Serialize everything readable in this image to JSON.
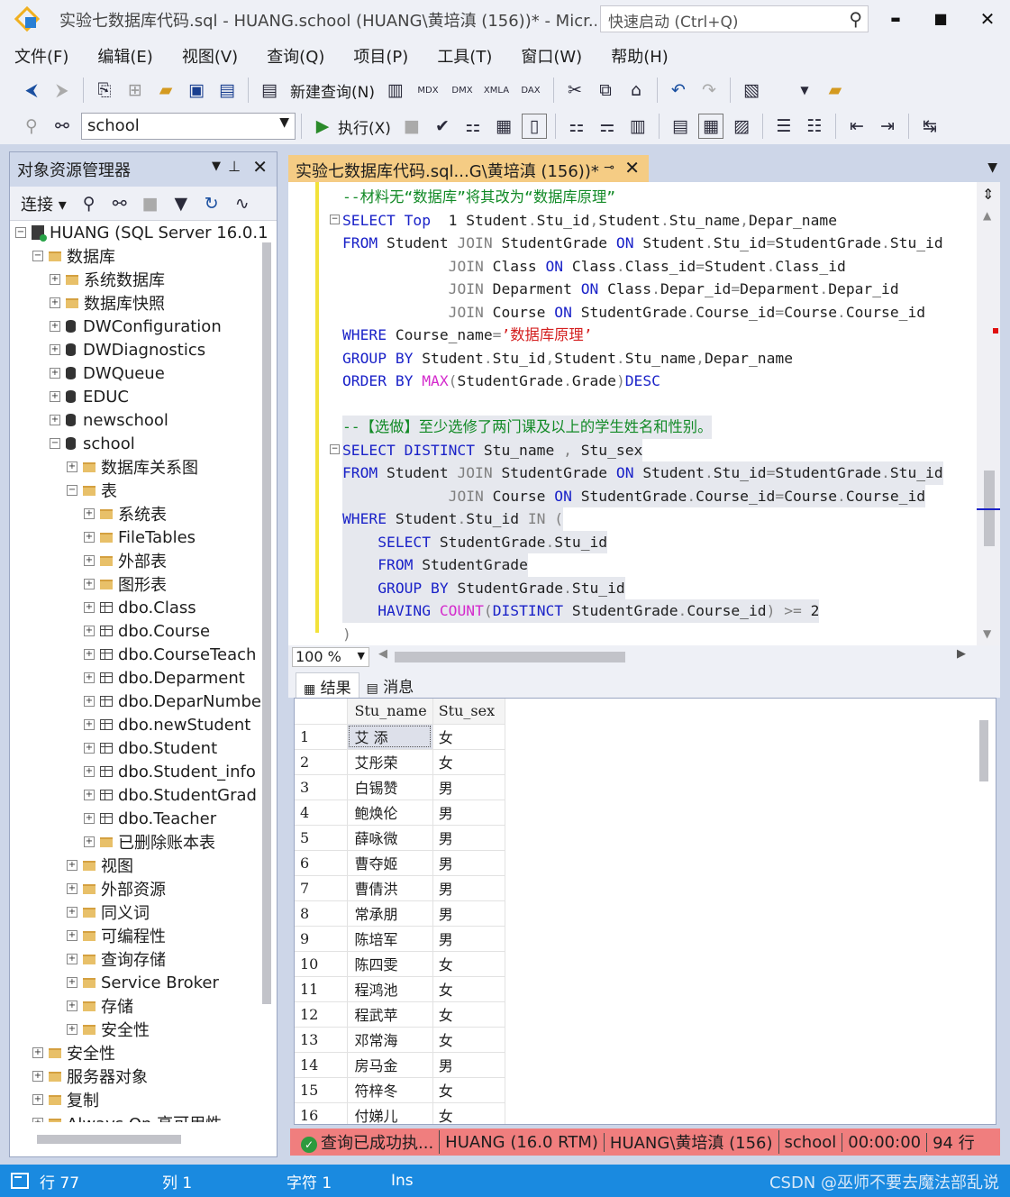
{
  "window": {
    "title": "实验七数据库代码.sql - HUANG.school (HUANG\\黄培滇 (156))* - Micr...",
    "quick_launch_placeholder": "快速启动 (Ctrl+Q)",
    "minimize": "▬",
    "maximize": "■",
    "close": "✕"
  },
  "menu": [
    "文件(F)",
    "编辑(E)",
    "视图(V)",
    "查询(Q)",
    "项目(P)",
    "工具(T)",
    "窗口(W)",
    "帮助(H)"
  ],
  "toolbar": {
    "new_query_label": "新建查询(N)",
    "database_value": "school",
    "execute_label": "执行(X)",
    "mdx": "MDX",
    "dmx": "DMX",
    "xmla": "XMLA",
    "dax": "DAX"
  },
  "object_explorer": {
    "title": "对象资源管理器",
    "connect_label": "连接",
    "server": "HUANG (SQL Server 16.0.1",
    "nodes": [
      {
        "label": "数据库",
        "indent": 1,
        "kind": "folder",
        "expanded": true
      },
      {
        "label": "系统数据库",
        "indent": 2,
        "kind": "folder"
      },
      {
        "label": "数据库快照",
        "indent": 2,
        "kind": "folder"
      },
      {
        "label": "DWConfiguration",
        "indent": 2,
        "kind": "db"
      },
      {
        "label": "DWDiagnostics",
        "indent": 2,
        "kind": "db"
      },
      {
        "label": "DWQueue",
        "indent": 2,
        "kind": "db"
      },
      {
        "label": "EDUC",
        "indent": 2,
        "kind": "db"
      },
      {
        "label": "newschool",
        "indent": 2,
        "kind": "db"
      },
      {
        "label": "school",
        "indent": 2,
        "kind": "db",
        "expanded": true
      },
      {
        "label": "数据库关系图",
        "indent": 3,
        "kind": "folder"
      },
      {
        "label": "表",
        "indent": 3,
        "kind": "folder",
        "expanded": true
      },
      {
        "label": "系统表",
        "indent": 4,
        "kind": "folder"
      },
      {
        "label": "FileTables",
        "indent": 4,
        "kind": "folder"
      },
      {
        "label": "外部表",
        "indent": 4,
        "kind": "folder"
      },
      {
        "label": "图形表",
        "indent": 4,
        "kind": "folder"
      },
      {
        "label": "dbo.Class",
        "indent": 4,
        "kind": "table"
      },
      {
        "label": "dbo.Course",
        "indent": 4,
        "kind": "table"
      },
      {
        "label": "dbo.CourseTeach",
        "indent": 4,
        "kind": "table"
      },
      {
        "label": "dbo.Deparment",
        "indent": 4,
        "kind": "table"
      },
      {
        "label": "dbo.DeparNumbe",
        "indent": 4,
        "kind": "table"
      },
      {
        "label": "dbo.newStudent",
        "indent": 4,
        "kind": "table"
      },
      {
        "label": "dbo.Student",
        "indent": 4,
        "kind": "table"
      },
      {
        "label": "dbo.Student_info",
        "indent": 4,
        "kind": "table"
      },
      {
        "label": "dbo.StudentGrad",
        "indent": 4,
        "kind": "table"
      },
      {
        "label": "dbo.Teacher",
        "indent": 4,
        "kind": "table"
      },
      {
        "label": "已删除账本表",
        "indent": 4,
        "kind": "folder"
      },
      {
        "label": "视图",
        "indent": 3,
        "kind": "folder"
      },
      {
        "label": "外部资源",
        "indent": 3,
        "kind": "folder"
      },
      {
        "label": "同义词",
        "indent": 3,
        "kind": "folder"
      },
      {
        "label": "可编程性",
        "indent": 3,
        "kind": "folder"
      },
      {
        "label": "查询存储",
        "indent": 3,
        "kind": "folder"
      },
      {
        "label": "Service Broker",
        "indent": 3,
        "kind": "folder"
      },
      {
        "label": "存储",
        "indent": 3,
        "kind": "folder"
      },
      {
        "label": "安全性",
        "indent": 3,
        "kind": "folder"
      },
      {
        "label": "安全性",
        "indent": 1,
        "kind": "folder"
      },
      {
        "label": "服务器对象",
        "indent": 1,
        "kind": "folder"
      },
      {
        "label": "复制",
        "indent": 1,
        "kind": "folder"
      },
      {
        "label": "Always On 高可用性",
        "indent": 1,
        "kind": "folder"
      }
    ]
  },
  "editor": {
    "tab_label": "实验七数据库代码.sql...G\\黄培滇 (156))*",
    "zoom": "100 %",
    "lines": [
      [
        [
          "cm",
          "--材料无“数据库”将其改为“数据库原理”"
        ]
      ],
      [
        [
          "kw",
          "SELECT Top"
        ],
        [
          "",
          "  1 Student"
        ],
        [
          "gr",
          "."
        ],
        [
          "",
          "Stu_id"
        ],
        [
          "gr",
          ","
        ],
        [
          "",
          "Student"
        ],
        [
          "gr",
          "."
        ],
        [
          "",
          "Stu_name"
        ],
        [
          "gr",
          ","
        ],
        [
          "",
          "Depar_name"
        ]
      ],
      [
        [
          "kw",
          "FROM"
        ],
        [
          "",
          " Student "
        ],
        [
          "gr",
          "JOIN"
        ],
        [
          "",
          " StudentGrade "
        ],
        [
          "kw",
          "ON"
        ],
        [
          "",
          " Student"
        ],
        [
          "gr",
          "."
        ],
        [
          "",
          "Stu_id"
        ],
        [
          "gr",
          "="
        ],
        [
          "",
          "StudentGrade"
        ],
        [
          "gr",
          "."
        ],
        [
          "",
          "Stu_id"
        ]
      ],
      [
        [
          "",
          "            "
        ],
        [
          "gr",
          "JOIN"
        ],
        [
          "",
          " Class "
        ],
        [
          "kw",
          "ON"
        ],
        [
          "",
          " Class"
        ],
        [
          "gr",
          "."
        ],
        [
          "",
          "Class_id"
        ],
        [
          "gr",
          "="
        ],
        [
          "",
          "Student"
        ],
        [
          "gr",
          "."
        ],
        [
          "",
          "Class_id"
        ]
      ],
      [
        [
          "",
          "            "
        ],
        [
          "gr",
          "JOIN"
        ],
        [
          "",
          " Deparment "
        ],
        [
          "kw",
          "ON"
        ],
        [
          "",
          " Class"
        ],
        [
          "gr",
          "."
        ],
        [
          "",
          "Depar_id"
        ],
        [
          "gr",
          "="
        ],
        [
          "",
          "Deparment"
        ],
        [
          "gr",
          "."
        ],
        [
          "",
          "Depar_id"
        ]
      ],
      [
        [
          "",
          "            "
        ],
        [
          "gr",
          "JOIN"
        ],
        [
          "",
          " Course "
        ],
        [
          "kw",
          "ON"
        ],
        [
          "",
          " StudentGrade"
        ],
        [
          "gr",
          "."
        ],
        [
          "",
          "Course_id"
        ],
        [
          "gr",
          "="
        ],
        [
          "",
          "Course"
        ],
        [
          "gr",
          "."
        ],
        [
          "",
          "Course_id"
        ]
      ],
      [
        [
          "kw",
          "WHERE"
        ],
        [
          "",
          " Course_name"
        ],
        [
          "gr",
          "="
        ],
        [
          "str",
          "’数据库原理’"
        ]
      ],
      [
        [
          "kw",
          "GROUP BY"
        ],
        [
          "",
          " Student"
        ],
        [
          "gr",
          "."
        ],
        [
          "",
          "Stu_id"
        ],
        [
          "gr",
          ","
        ],
        [
          "",
          "Student"
        ],
        [
          "gr",
          "."
        ],
        [
          "",
          "Stu_name"
        ],
        [
          "gr",
          ","
        ],
        [
          "",
          "Depar_name"
        ]
      ],
      [
        [
          "kw",
          "ORDER BY"
        ],
        [
          "",
          " "
        ],
        [
          "fn",
          "MAX"
        ],
        [
          "gr",
          "("
        ],
        [
          "",
          "StudentGrade"
        ],
        [
          "gr",
          "."
        ],
        [
          "",
          "Grade"
        ],
        [
          "gr",
          ")"
        ],
        [
          "kw",
          "DESC"
        ]
      ],
      [
        [
          "",
          ""
        ]
      ],
      [
        [
          "cm",
          "--【选做】至少选修了两门课及以上的学生姓名和性别。"
        ]
      ],
      [
        [
          "kw",
          "SELECT DISTINCT"
        ],
        [
          "",
          " Stu_name "
        ],
        [
          "gr",
          ","
        ],
        [
          "",
          " Stu_sex"
        ]
      ],
      [
        [
          "kw",
          "FROM"
        ],
        [
          "",
          " Student "
        ],
        [
          "gr",
          "JOIN"
        ],
        [
          "",
          " StudentGrade "
        ],
        [
          "kw",
          "ON"
        ],
        [
          "",
          " Student"
        ],
        [
          "gr",
          "."
        ],
        [
          "",
          "Stu_id"
        ],
        [
          "gr",
          "="
        ],
        [
          "",
          "StudentGrade"
        ],
        [
          "gr",
          "."
        ],
        [
          "",
          "Stu_id"
        ]
      ],
      [
        [
          "",
          "            "
        ],
        [
          "gr",
          "JOIN"
        ],
        [
          "",
          " Course "
        ],
        [
          "kw",
          "ON"
        ],
        [
          "",
          " StudentGrade"
        ],
        [
          "gr",
          "."
        ],
        [
          "",
          "Course_id"
        ],
        [
          "gr",
          "="
        ],
        [
          "",
          "Course"
        ],
        [
          "gr",
          "."
        ],
        [
          "",
          "Course_id"
        ]
      ],
      [
        [
          "kw",
          "WHERE"
        ],
        [
          "",
          " Student"
        ],
        [
          "gr",
          "."
        ],
        [
          "",
          "Stu_id "
        ],
        [
          "gr",
          "IN ("
        ]
      ],
      [
        [
          "",
          "    "
        ],
        [
          "kw",
          "SELECT"
        ],
        [
          "",
          " StudentGrade"
        ],
        [
          "gr",
          "."
        ],
        [
          "",
          "Stu_id"
        ]
      ],
      [
        [
          "",
          "    "
        ],
        [
          "kw",
          "FROM"
        ],
        [
          "",
          " StudentGrade"
        ]
      ],
      [
        [
          "",
          "    "
        ],
        [
          "kw",
          "GROUP BY"
        ],
        [
          "",
          " StudentGrade"
        ],
        [
          "gr",
          "."
        ],
        [
          "",
          "Stu_id"
        ]
      ],
      [
        [
          "",
          "    "
        ],
        [
          "kw",
          "HAVING"
        ],
        [
          "",
          " "
        ],
        [
          "fn",
          "COUNT"
        ],
        [
          "gr",
          "("
        ],
        [
          "kw",
          "DISTINCT"
        ],
        [
          "",
          " StudentGrade"
        ],
        [
          "gr",
          "."
        ],
        [
          "",
          "Course_id"
        ],
        [
          "gr",
          ")"
        ],
        [
          "",
          " "
        ],
        [
          "gr",
          ">="
        ],
        [
          "",
          " 2"
        ]
      ],
      [
        [
          "gr",
          ")"
        ]
      ]
    ]
  },
  "results": {
    "tab_results": "结果",
    "tab_messages": "消息",
    "columns": [
      "Stu_name",
      "Stu_sex"
    ],
    "rows": [
      [
        "1",
        "艾  添",
        "女"
      ],
      [
        "2",
        "艾彤荣",
        "女"
      ],
      [
        "3",
        "白锡赞",
        "男"
      ],
      [
        "4",
        "鲍焕伦",
        "男"
      ],
      [
        "5",
        "薛咏微",
        "男"
      ],
      [
        "6",
        "曹夺姬",
        "男"
      ],
      [
        "7",
        "曹倩洪",
        "男"
      ],
      [
        "8",
        "常承朋",
        "男"
      ],
      [
        "9",
        "陈培军",
        "男"
      ],
      [
        "10",
        "陈四雯",
        "女"
      ],
      [
        "11",
        "程鸿池",
        "女"
      ],
      [
        "12",
        "程武苹",
        "女"
      ],
      [
        "13",
        "邓常海",
        "女"
      ],
      [
        "14",
        "房马金",
        "男"
      ],
      [
        "15",
        "符梓冬",
        "女"
      ],
      [
        "16",
        "付娣儿",
        "女"
      ]
    ]
  },
  "query_status": {
    "message": "查询已成功执...",
    "server": "HUANG (16.0 RTM)",
    "user": "HUANG\\黄培滇 (156)",
    "database": "school",
    "elapsed": "00:00:00",
    "rows": "94 行"
  },
  "statusbar": {
    "line": "行 77",
    "col": "列 1",
    "char": "字符 1",
    "mode": "Ins",
    "watermark": "CSDN @巫师不要去魔法部乱说"
  }
}
